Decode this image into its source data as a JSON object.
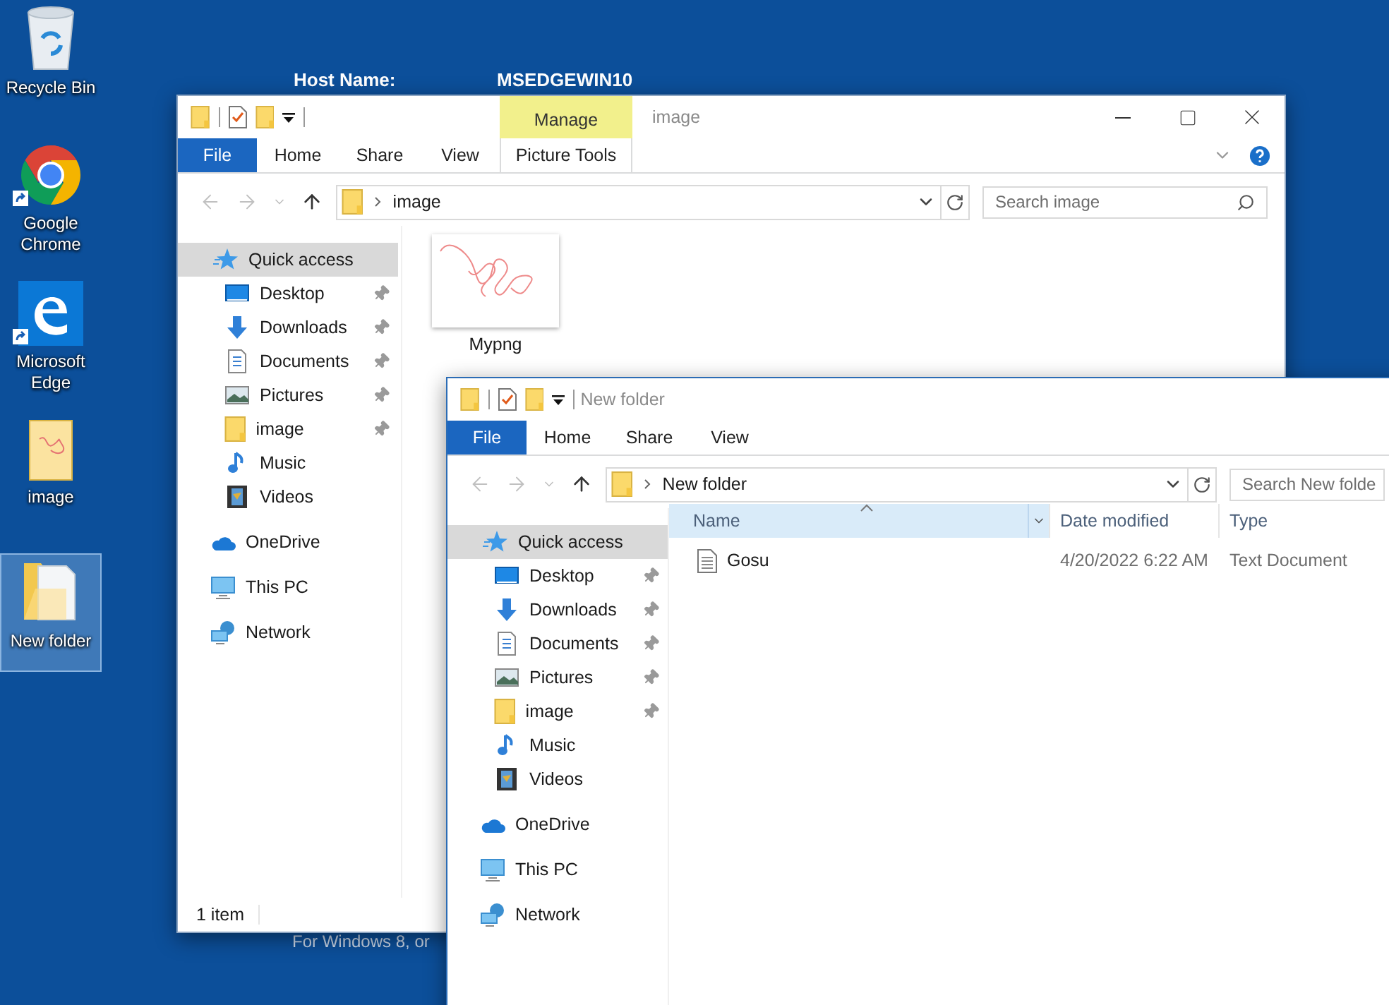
{
  "desktop": {
    "host_name": {
      "label": "Host Name:",
      "value": "MSEDGEWIN10"
    },
    "icons": [
      {
        "label": "Recycle Bin",
        "kind": "recycle",
        "selected": false,
        "shortcut": false
      },
      {
        "label": "Google Chrome",
        "kind": "chrome",
        "selected": false,
        "shortcut": true
      },
      {
        "label": "Microsoft Edge",
        "kind": "edge",
        "selected": false,
        "shortcut": true
      },
      {
        "label": "image",
        "kind": "image-folder",
        "selected": false,
        "shortcut": false
      },
      {
        "label": "New folder",
        "kind": "folder",
        "selected": true,
        "shortcut": false
      }
    ],
    "background_text": "For Windows 8, or"
  },
  "windows": [
    {
      "title": "image",
      "contextual_tab": {
        "label": "Manage",
        "tab": "Picture Tools"
      },
      "ribbon_tabs": [
        {
          "label": "File",
          "kind": "file"
        },
        {
          "label": "Home",
          "kind": "tab"
        },
        {
          "label": "Share",
          "kind": "tab"
        },
        {
          "label": "View",
          "kind": "tab"
        }
      ],
      "address": "image",
      "search_placeholder": "Search image",
      "status": "1 item",
      "nav": [
        {
          "label": "Quick access",
          "kind": "star",
          "selected": true,
          "children": [
            {
              "label": "Desktop",
              "kind": "desktop",
              "pinned": true,
              "selected": false
            },
            {
              "label": "Downloads",
              "kind": "download",
              "pinned": true,
              "selected": false
            },
            {
              "label": "Documents",
              "kind": "documents",
              "pinned": true,
              "selected": false
            },
            {
              "label": "Pictures",
              "kind": "pictures",
              "pinned": true,
              "selected": false
            },
            {
              "label": "image",
              "kind": "folder",
              "pinned": true,
              "selected": false
            },
            {
              "label": "Music",
              "kind": "music",
              "pinned": false,
              "selected": false
            },
            {
              "label": "Videos",
              "kind": "videos",
              "pinned": false,
              "selected": false
            }
          ]
        },
        {
          "label": "OneDrive",
          "kind": "cloud",
          "selected": false
        },
        {
          "label": "This PC",
          "kind": "pc",
          "selected": false
        },
        {
          "label": "Network",
          "kind": "network",
          "selected": false
        }
      ],
      "content": {
        "kind": "icons",
        "items": [
          {
            "label": "Mypng",
            "kind": "picture"
          }
        ]
      }
    },
    {
      "title": "New folder",
      "ribbon_tabs": [
        {
          "label": "File",
          "kind": "file"
        },
        {
          "label": "Home",
          "kind": "tab"
        },
        {
          "label": "Share",
          "kind": "tab"
        },
        {
          "label": "View",
          "kind": "tab"
        }
      ],
      "address": "New folder",
      "search_placeholder": "Search New folde",
      "nav": [
        {
          "label": "Quick access",
          "kind": "star",
          "selected": true,
          "children": [
            {
              "label": "Desktop",
              "kind": "desktop",
              "pinned": true,
              "selected": false
            },
            {
              "label": "Downloads",
              "kind": "download",
              "pinned": true,
              "selected": false
            },
            {
              "label": "Documents",
              "kind": "documents",
              "pinned": true,
              "selected": false
            },
            {
              "label": "Pictures",
              "kind": "pictures",
              "pinned": true,
              "selected": false
            },
            {
              "label": "image",
              "kind": "folder",
              "pinned": true,
              "selected": false
            },
            {
              "label": "Music",
              "kind": "music",
              "pinned": false,
              "selected": false
            },
            {
              "label": "Videos",
              "kind": "videos",
              "pinned": false,
              "selected": false
            }
          ]
        },
        {
          "label": "OneDrive",
          "kind": "cloud",
          "selected": false
        },
        {
          "label": "This PC",
          "kind": "pc",
          "selected": false
        },
        {
          "label": "Network",
          "kind": "network",
          "selected": false
        }
      ],
      "content": {
        "kind": "details",
        "columns": [
          {
            "label": "Name",
            "sorted": true
          },
          {
            "label": "Date modified",
            "sorted": false
          },
          {
            "label": "Type",
            "sorted": false
          }
        ],
        "rows": [
          {
            "cells": [
              "Gosu",
              "4/20/2022 6:22 AM",
              "Text Document"
            ]
          }
        ]
      }
    }
  ]
}
